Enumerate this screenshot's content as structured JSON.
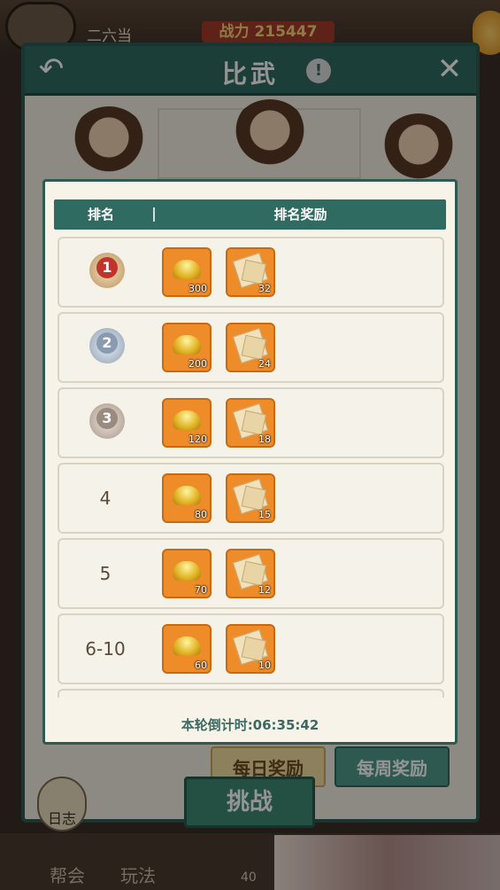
{
  "status_bar": {
    "player_name": "二六当",
    "power_text": "战力 215447"
  },
  "arena": {
    "title": "比武",
    "info_icon": "!",
    "back_icon": "back-arrow-icon",
    "close_icon": "close-icon"
  },
  "dialog": {
    "header": {
      "rank": "排名",
      "reward": "排名奖励"
    },
    "rows": [
      {
        "rank": "1",
        "medal": "gold",
        "ingot_qty": "300",
        "scroll_qty": "32"
      },
      {
        "rank": "2",
        "medal": "silver",
        "ingot_qty": "200",
        "scroll_qty": "24"
      },
      {
        "rank": "3",
        "medal": "bronze",
        "ingot_qty": "120",
        "scroll_qty": "18"
      },
      {
        "rank": "4",
        "medal": "",
        "ingot_qty": "80",
        "scroll_qty": "15"
      },
      {
        "rank": "5",
        "medal": "",
        "ingot_qty": "70",
        "scroll_qty": "12"
      },
      {
        "rank": "6-10",
        "medal": "",
        "ingot_qty": "60",
        "scroll_qty": "10"
      }
    ],
    "countdown": "本轮倒计时:06:35:42"
  },
  "buttons": {
    "daily": "每日奖励",
    "weekly": "每周奖励",
    "challenge": "挑战",
    "log": "日志"
  },
  "bottom_nav": {
    "guild": "帮会",
    "play": "玩法",
    "count": "40"
  },
  "colors": {
    "teal_header": "#2f6b61",
    "item_orange": "#ee8c2a",
    "panel_bg": "#f7f3e8"
  }
}
